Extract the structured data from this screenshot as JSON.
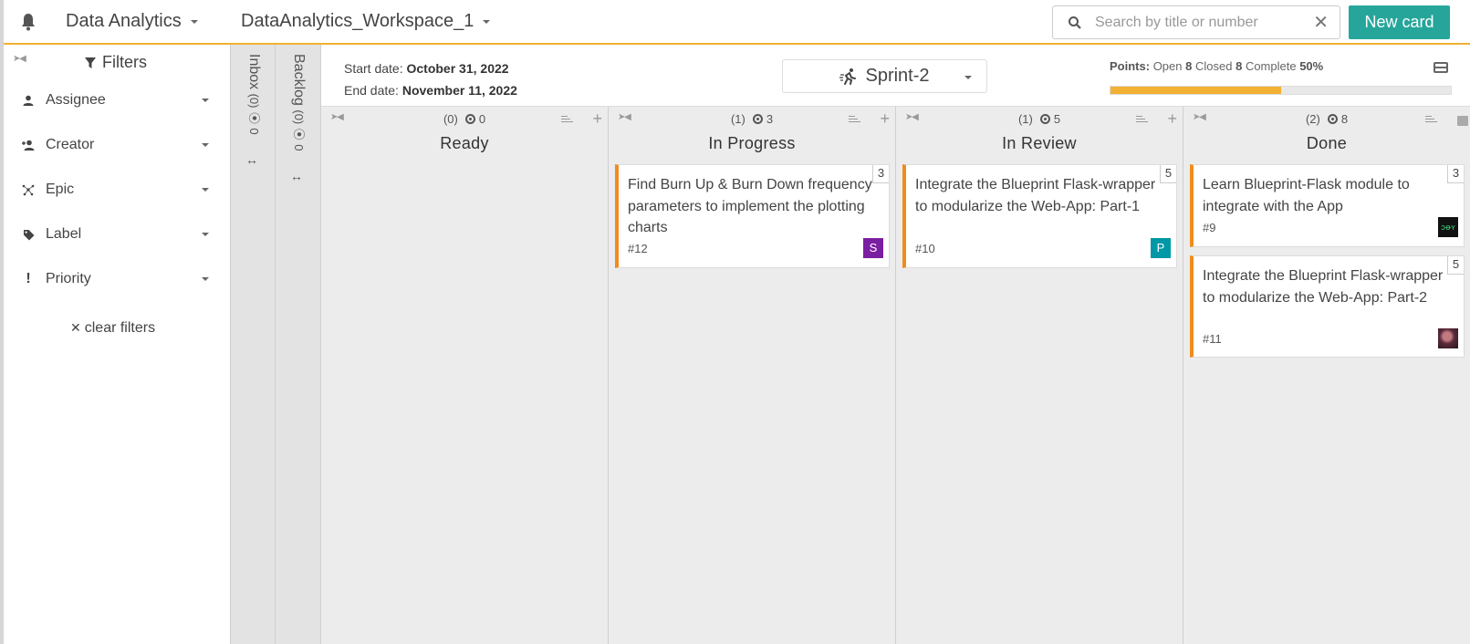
{
  "header": {
    "project": "Data Analytics",
    "workspace": "DataAnalytics_Workspace_1",
    "search_placeholder": "Search by title or number",
    "new_card_label": "New card"
  },
  "sidebar": {
    "title": "Filters",
    "items": [
      {
        "label": "Assignee",
        "icon": "person-icon"
      },
      {
        "label": "Creator",
        "icon": "person-add-icon"
      },
      {
        "label": "Epic",
        "icon": "epic-icon"
      },
      {
        "label": "Label",
        "icon": "tag-icon"
      },
      {
        "label": "Priority",
        "icon": "exclamation-icon"
      }
    ],
    "clear_label": "clear filters"
  },
  "side_columns": {
    "inbox": {
      "label": "Inbox",
      "count": "(0)",
      "points": "0"
    },
    "backlog": {
      "label": "Backlog",
      "count": "(0)",
      "points": "0"
    }
  },
  "sprint": {
    "start_label": "Start date:",
    "start_date": "October 31, 2022",
    "end_label": "End date:",
    "end_date": "November 11, 2022",
    "name": "Sprint-2",
    "points_label": "Points:",
    "open_label": "Open",
    "open": "8",
    "closed_label": "Closed",
    "closed": "8",
    "complete_label": "Complete",
    "complete": "50%",
    "progress_fraction": 0.5
  },
  "columns": [
    {
      "title": "Ready",
      "count": "(0)",
      "points": "0",
      "cards": []
    },
    {
      "title": "In Progress",
      "count": "(1)",
      "points": "3",
      "cards": [
        {
          "title": "Find Burn Up & Burn Down frequency parameters to implement the plotting charts",
          "number": "#12",
          "points": "3",
          "avatar": "S",
          "avatar_color": "#7b1fa2"
        }
      ]
    },
    {
      "title": "In Review",
      "count": "(1)",
      "points": "5",
      "cards": [
        {
          "title": "Integrate the Blueprint Flask-wrapper to modularize the Web-App: Part-1",
          "number": "#10",
          "points": "5",
          "avatar": "P",
          "avatar_color": "#0097a7"
        }
      ]
    },
    {
      "title": "Done",
      "count": "(2)",
      "points": "8",
      "cards": [
        {
          "title": "Learn Blueprint-Flask module to integrate with the App",
          "number": "#9",
          "points": "3",
          "avatar": "",
          "avatar_color": "#111111"
        },
        {
          "title": "Integrate the Blueprint Flask-wrapper to modularize the Web-App: Part-2",
          "number": "#11",
          "points": "5",
          "avatar": "",
          "avatar_color": "#5a2a3a"
        }
      ]
    }
  ],
  "colors": {
    "accent": "#26a69a",
    "progress": "#f2b134",
    "card_border": "#f08c1e"
  }
}
